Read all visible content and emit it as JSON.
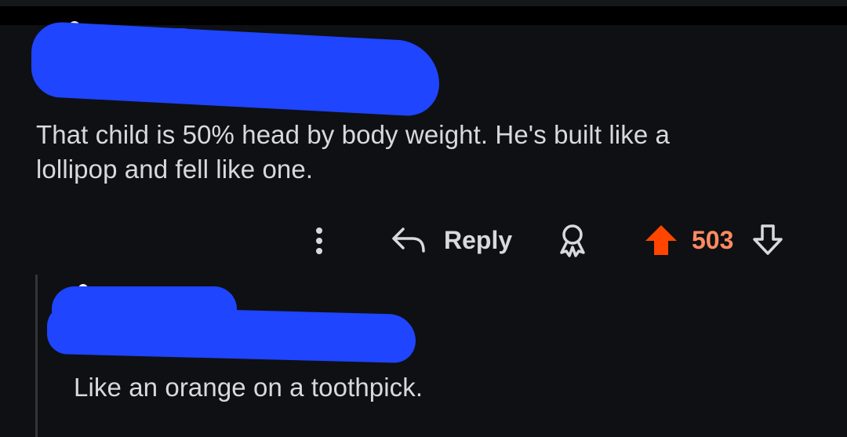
{
  "comment": {
    "author_redacted": true,
    "body_line1": "That child is 50% head by body weight. He's built like a",
    "body_line2": "lollipop and fell like one."
  },
  "actions": {
    "more_icon": "more-vertical-icon",
    "reply_icon": "reply-arrow-icon",
    "reply_label": "Reply",
    "award_icon": "award-icon",
    "upvote_icon": "upvote-arrow-icon",
    "score": "503",
    "downvote_icon": "downvote-arrow-icon"
  },
  "reply": {
    "author_redacted": true,
    "body": "Like an orange on a toothpick."
  },
  "colors": {
    "background": "#0e1013",
    "text": "#d7dadc",
    "upvoted": "#ff4500",
    "score": "#ff8b60",
    "redaction": "#1f45ff",
    "thread_line": "#343536"
  }
}
